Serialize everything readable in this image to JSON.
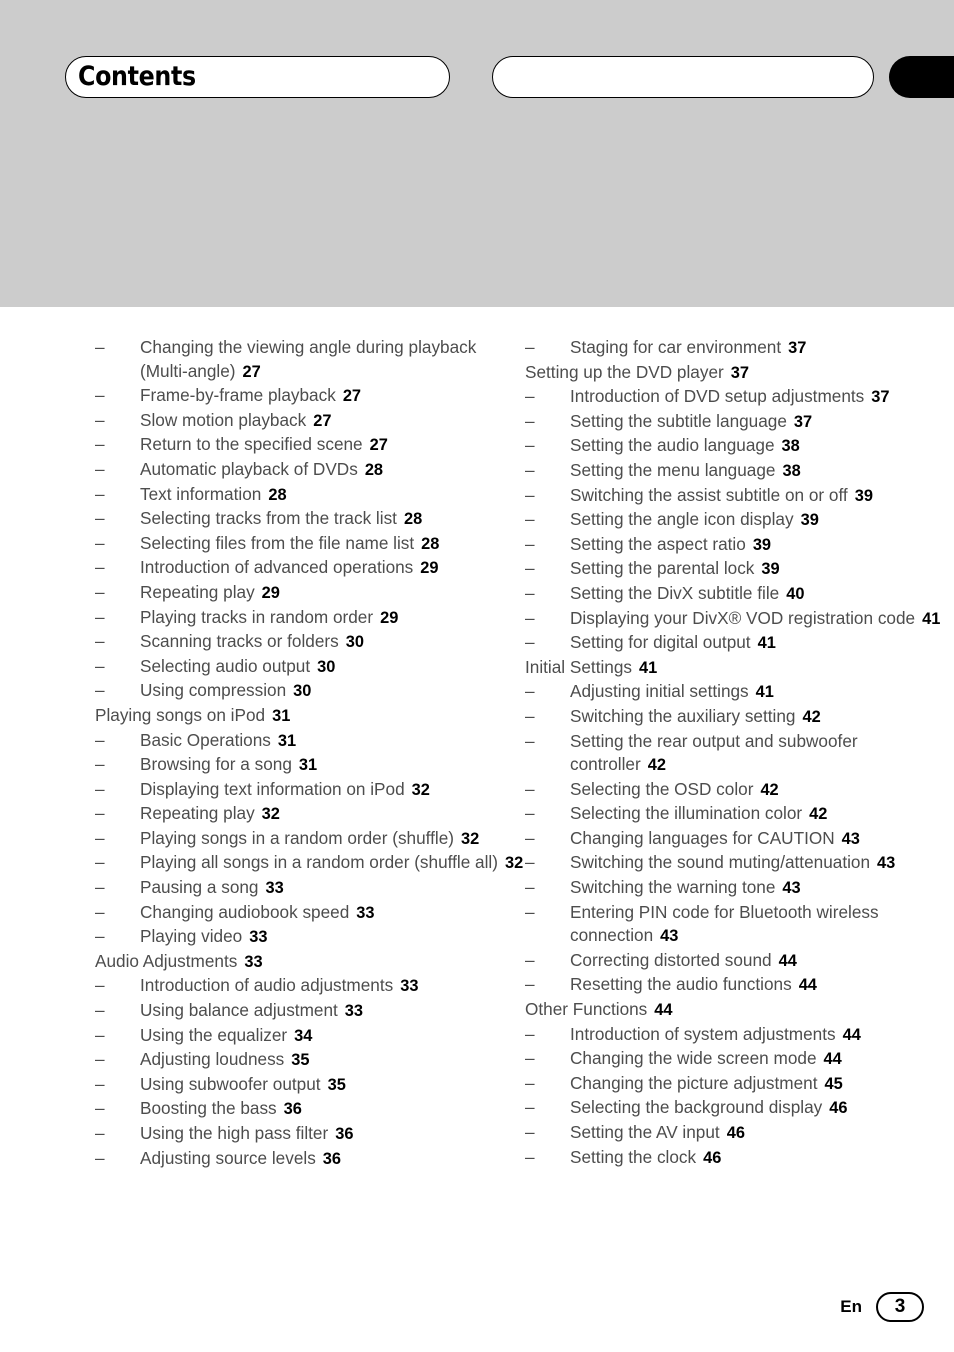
{
  "header": {
    "title": "Contents",
    "running_head": "",
    "thumb_tab": ""
  },
  "footer": {
    "language": "En",
    "page_number": "3"
  },
  "toc": {
    "left_column": [
      {
        "type": "sub",
        "label": "Changing the viewing angle during playback (Multi-angle)",
        "page": "27"
      },
      {
        "type": "sub",
        "label": "Frame-by-frame playback",
        "page": "27"
      },
      {
        "type": "sub",
        "label": "Slow motion playback",
        "page": "27"
      },
      {
        "type": "sub",
        "label": "Return to the specified scene",
        "page": "27"
      },
      {
        "type": "sub",
        "label": "Automatic playback of DVDs",
        "page": "28"
      },
      {
        "type": "sub",
        "label": "Text information",
        "page": "28"
      },
      {
        "type": "sub",
        "label": "Selecting tracks from the track list",
        "page": "28"
      },
      {
        "type": "sub",
        "label": "Selecting files from the file name list",
        "page": "28"
      },
      {
        "type": "sub",
        "label": "Introduction of advanced operations",
        "page": "29"
      },
      {
        "type": "sub",
        "label": "Repeating play",
        "page": "29"
      },
      {
        "type": "sub",
        "label": "Playing tracks in random order",
        "page": "29"
      },
      {
        "type": "sub",
        "label": "Scanning tracks or folders",
        "page": "30"
      },
      {
        "type": "sub",
        "label": "Selecting audio output",
        "page": "30"
      },
      {
        "type": "sub",
        "label": "Using compression",
        "page": "30"
      },
      {
        "type": "section",
        "label": "Playing songs on iPod",
        "page": "31"
      },
      {
        "type": "sub",
        "label": "Basic Operations",
        "page": "31"
      },
      {
        "type": "sub",
        "label": "Browsing for a song",
        "page": "31"
      },
      {
        "type": "sub",
        "label": "Displaying text information on iPod",
        "page": "32"
      },
      {
        "type": "sub",
        "label": "Repeating play",
        "page": "32"
      },
      {
        "type": "sub",
        "label": "Playing songs in a random order (shuffle)",
        "page": "32"
      },
      {
        "type": "sub",
        "label": "Playing all songs in a random order (shuffle all)",
        "page": "32"
      },
      {
        "type": "sub",
        "label": "Pausing a song",
        "page": "33"
      },
      {
        "type": "sub",
        "label": "Changing audiobook speed",
        "page": "33"
      },
      {
        "type": "sub",
        "label": "Playing video",
        "page": "33"
      },
      {
        "type": "section",
        "label": "Audio Adjustments",
        "page": "33"
      },
      {
        "type": "sub",
        "label": "Introduction of audio adjustments",
        "page": "33"
      },
      {
        "type": "sub",
        "label": "Using balance adjustment",
        "page": "33"
      },
      {
        "type": "sub",
        "label": "Using the equalizer",
        "page": "34"
      },
      {
        "type": "sub",
        "label": "Adjusting loudness",
        "page": "35"
      },
      {
        "type": "sub",
        "label": "Using subwoofer output",
        "page": "35"
      },
      {
        "type": "sub",
        "label": "Boosting the bass",
        "page": "36"
      },
      {
        "type": "sub",
        "label": "Using the high pass filter",
        "page": "36"
      },
      {
        "type": "sub",
        "label": "Adjusting source levels",
        "page": "36"
      }
    ],
    "right_column": [
      {
        "type": "sub",
        "label": "Staging for car environment",
        "page": "37"
      },
      {
        "type": "section",
        "label": "Setting up the DVD player",
        "page": "37"
      },
      {
        "type": "sub",
        "label": "Introduction of DVD setup adjustments",
        "page": "37"
      },
      {
        "type": "sub",
        "label": "Setting the subtitle language",
        "page": "37"
      },
      {
        "type": "sub",
        "label": "Setting the audio language",
        "page": "38"
      },
      {
        "type": "sub",
        "label": "Setting the menu language",
        "page": "38"
      },
      {
        "type": "sub",
        "label": "Switching the assist subtitle on or off",
        "page": "39"
      },
      {
        "type": "sub",
        "label": "Setting the angle icon display",
        "page": "39"
      },
      {
        "type": "sub",
        "label": "Setting the aspect ratio",
        "page": "39"
      },
      {
        "type": "sub",
        "label": "Setting the parental lock",
        "page": "39"
      },
      {
        "type": "sub",
        "label": "Setting the DivX subtitle file",
        "page": "40"
      },
      {
        "type": "sub",
        "label": "Displaying your DivX® VOD registration code",
        "page": "41"
      },
      {
        "type": "sub",
        "label": "Setting for digital output",
        "page": "41"
      },
      {
        "type": "section",
        "label": "Initial Settings",
        "page": "41"
      },
      {
        "type": "sub",
        "label": "Adjusting initial settings",
        "page": "41"
      },
      {
        "type": "sub",
        "label": "Switching the auxiliary setting",
        "page": "42"
      },
      {
        "type": "sub",
        "label": "Setting the rear output and subwoofer controller",
        "page": "42"
      },
      {
        "type": "sub",
        "label": "Selecting the OSD color",
        "page": "42"
      },
      {
        "type": "sub",
        "label": "Selecting the illumination color",
        "page": "42"
      },
      {
        "type": "sub",
        "label": "Changing languages for CAUTION",
        "page": "43"
      },
      {
        "type": "sub",
        "label": "Switching the sound muting/attenuation",
        "page": "43"
      },
      {
        "type": "sub",
        "label": "Switching the warning tone",
        "page": "43"
      },
      {
        "type": "sub",
        "label": "Entering PIN code for Bluetooth wireless connection",
        "page": "43"
      },
      {
        "type": "sub",
        "label": "Correcting distorted sound",
        "page": "44"
      },
      {
        "type": "sub",
        "label": "Resetting the audio functions",
        "page": "44"
      },
      {
        "type": "section",
        "label": "Other Functions",
        "page": "44"
      },
      {
        "type": "sub",
        "label": "Introduction of system adjustments",
        "page": "44"
      },
      {
        "type": "sub",
        "label": "Changing the wide screen mode",
        "page": "44"
      },
      {
        "type": "sub",
        "label": "Changing the picture adjustment",
        "page": "45"
      },
      {
        "type": "sub",
        "label": "Selecting the background display",
        "page": "46"
      },
      {
        "type": "sub",
        "label": "Setting the AV input",
        "page": "46"
      },
      {
        "type": "sub",
        "label": "Setting the clock",
        "page": "46"
      }
    ]
  },
  "colors": {
    "header_band": "#cccccc",
    "text": "#4d4d4d",
    "pageno": "#000000",
    "tab": "#000000"
  }
}
